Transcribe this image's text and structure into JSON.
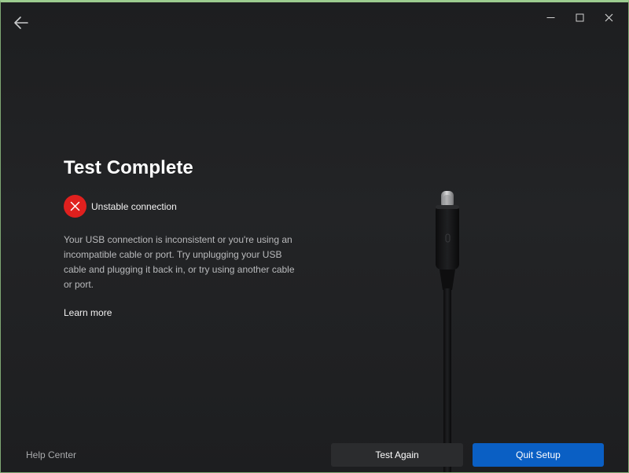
{
  "window": {
    "back_icon": "arrow-left-icon",
    "controls": [
      {
        "name": "minimize-button",
        "icon": "minimize-icon"
      },
      {
        "name": "maximize-button",
        "icon": "maximize-icon"
      },
      {
        "name": "close-button",
        "icon": "close-icon"
      }
    ]
  },
  "main": {
    "title": "Test Complete",
    "status": {
      "icon": "x-icon",
      "icon_color": "#e0201e",
      "label": "Unstable connection"
    },
    "description": "Your USB connection is inconsistent or you're using an incompatible cable or port. Try unplugging your USB cable and plugging it back in, or try using another cable or port.",
    "learn_more": "Learn more",
    "illustration": "usb-c-cable-illustration"
  },
  "footer": {
    "help_center": "Help Center",
    "test_again_label": "Test Again",
    "quit_setup_label": "Quit Setup",
    "primary_color": "#0a5fc4"
  }
}
